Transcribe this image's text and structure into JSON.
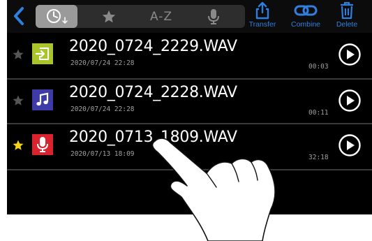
{
  "toolbar": {
    "sort_az_label": "A-Z",
    "transfer_label": "Transfer",
    "combine_label": "Combine",
    "delete_label": "Delete"
  },
  "files": [
    {
      "name": "2020_0724_2229.WAV",
      "date": "2020/07/24 22:28",
      "duration": "00:03",
      "starred": false,
      "icon": "file-import-icon",
      "icon_color": "#a8c62c"
    },
    {
      "name": "2020_0724_2228.WAV",
      "date": "2020/07/24 22:28",
      "duration": "00:11",
      "starred": false,
      "icon": "music-note-icon",
      "icon_color": "#3e3aa8"
    },
    {
      "name": "2020_0713_1809.WAV",
      "date": "2020/07/13 18:09",
      "duration": "32:18",
      "starred": true,
      "icon": "microphone-icon",
      "icon_color": "#d9232e"
    }
  ],
  "colors": {
    "accent": "#2f7fe0",
    "star_active": "#f2d21b",
    "star_inactive": "#555555"
  }
}
